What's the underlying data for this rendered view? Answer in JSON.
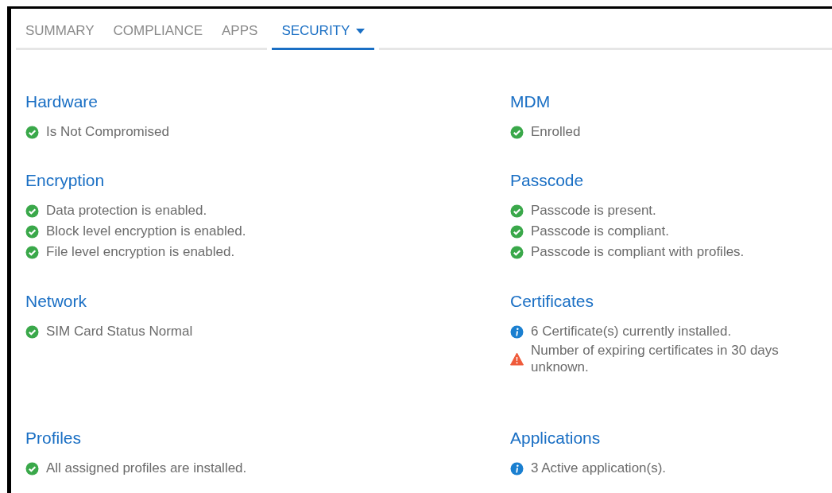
{
  "tabs": [
    {
      "label": "SUMMARY",
      "selected": false
    },
    {
      "label": "COMPLIANCE",
      "selected": false
    },
    {
      "label": "APPS",
      "selected": false
    },
    {
      "label": "SECURITY",
      "selected": true,
      "dropdown": true
    }
  ],
  "sections": [
    {
      "title": "Hardware",
      "items": [
        {
          "kind": "ok",
          "text": "Is Not Compromised"
        }
      ]
    },
    {
      "title": "MDM",
      "items": [
        {
          "kind": "ok",
          "text": "Enrolled"
        }
      ]
    },
    {
      "title": "Encryption",
      "items": [
        {
          "kind": "ok",
          "text": "Data protection is enabled."
        },
        {
          "kind": "ok",
          "text": "Block level encryption is enabled."
        },
        {
          "kind": "ok",
          "text": "File level encryption is enabled."
        }
      ]
    },
    {
      "title": "Passcode",
      "items": [
        {
          "kind": "ok",
          "text": "Passcode is present."
        },
        {
          "kind": "ok",
          "text": "Passcode is compliant."
        },
        {
          "kind": "ok",
          "text": "Passcode is compliant with profiles."
        }
      ]
    },
    {
      "title": "Network",
      "items": [
        {
          "kind": "ok",
          "text": "SIM Card Status Normal"
        }
      ]
    },
    {
      "title": "Certificates",
      "items": [
        {
          "kind": "info",
          "text": "6 Certificate(s) currently installed."
        },
        {
          "kind": "warning",
          "text": "Number of expiring certificates in 30 days unknown."
        }
      ]
    },
    {
      "title": "Profiles",
      "items": [
        {
          "kind": "ok",
          "text": "All assigned profiles are installed."
        }
      ]
    },
    {
      "title": "Applications",
      "items": [
        {
          "kind": "info",
          "text": "3 Active application(s)."
        }
      ]
    }
  ]
}
